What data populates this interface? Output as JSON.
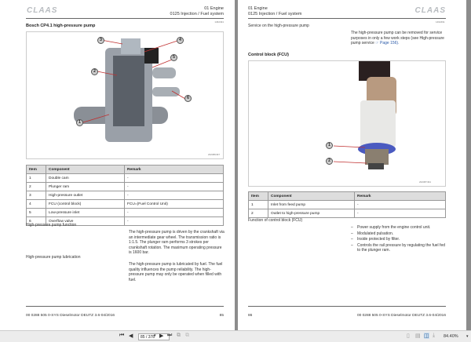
{
  "header": {
    "logo": "CLAAS",
    "chapter": "01 Engine",
    "section": "0125 Injection / Fuel system"
  },
  "left": {
    "code": "1462491",
    "title": "Bosch CP4.1 high-pressure pump",
    "image_code": "202086497",
    "callouts": [
      "1",
      "2",
      "3",
      "4",
      "5",
      "6"
    ],
    "table": {
      "headers": [
        "Item",
        "Component",
        "Remark"
      ],
      "rows": [
        [
          "1",
          "Double cam",
          "-"
        ],
        [
          "2",
          "Plunger ram",
          "-"
        ],
        [
          "3",
          "High-pressure outlet",
          "-"
        ],
        [
          "4",
          "FCU (control block)",
          "FCU=(Fuel Control Unit)"
        ],
        [
          "5",
          "Low-pressure inlet",
          "-"
        ],
        [
          "6",
          "Overflow valve",
          "-"
        ]
      ]
    },
    "function_heading": "High-pressure pump function",
    "function_text": "The high-pressure pump is driven by the crankshaft via an intermediate gear wheel. The transmission ratio is 1:1.5. The plunger ram performs 3 strokes per crankshaft rotation. The maximum operating pressure is 1600 bar.",
    "lubrication_heading": "High-pressure pump lubrication",
    "lubrication_text": "The high-pressure pump is lubricated by fuel. The fuel quality influences the pump reliability. The high-pressure pump may only be operated when filled with fuel.",
    "footer_doc": "00 0288 505 0-SYS Dieselmotor DEUTZ 3.6-04/2016",
    "page_no": "85"
  },
  "right": {
    "code": "1462491",
    "service_heading": "Service on the high-pressure pump",
    "service_text": "The high-pressure pump can be removed for service purposes in only a few work steps (see High-pressure pump service",
    "service_link": "☞ Page 156).",
    "title": "Control block (FCU)",
    "image_code": "202087491",
    "callouts": [
      "1",
      "2"
    ],
    "table": {
      "headers": [
        "Item",
        "Component",
        "Remark"
      ],
      "rows": [
        [
          "1",
          "Inlet from feed pump",
          "-"
        ],
        [
          "2",
          "Outlet to high-pressure pump",
          "-"
        ]
      ]
    },
    "function_heading": "Function of control block (FCU)",
    "bullets": [
      "Power supply from the engine control unit.",
      "Modulated pulsation.",
      "Inside protected by filter.",
      "Controls the rail pressure by regulating the fuel fed to the plunger ram."
    ],
    "footer_doc": "00 0288 505 0-SYS Dieselmotor DEUTZ 3.6-04/2016",
    "page_no": "86"
  },
  "toolbar": {
    "page_value": "85 / 378",
    "zoom": "84.40%"
  }
}
